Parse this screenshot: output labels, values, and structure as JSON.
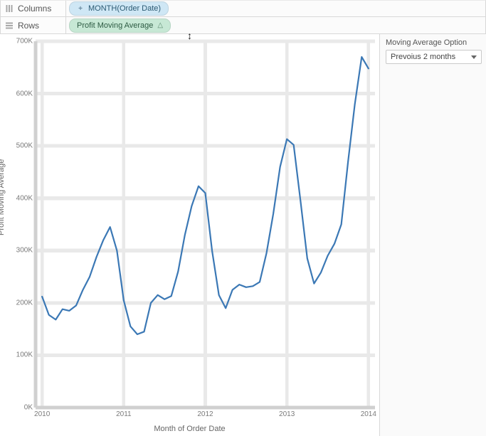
{
  "shelves": {
    "columns_label": "Columns",
    "rows_label": "Rows",
    "columns_pill": "MONTH(Order Date)",
    "rows_pill": "Profit Moving Average"
  },
  "parameter": {
    "title": "Moving Average Option",
    "value": "Prevoius 2 months"
  },
  "chart_data": {
    "type": "line",
    "xlabel": "Month of Order Date",
    "ylabel": "Profit Moving Average",
    "ylim": [
      0,
      700000
    ],
    "y_ticks": [
      0,
      100000,
      200000,
      300000,
      400000,
      500000,
      600000,
      700000
    ],
    "y_tick_labels": [
      "0K",
      "100K",
      "200K",
      "300K",
      "400K",
      "500K",
      "600K",
      "700K"
    ],
    "x_ticks": [
      2010,
      2011,
      2012,
      2013,
      2014
    ],
    "x_tick_labels": [
      "2010",
      "2011",
      "2012",
      "2013",
      "2014"
    ],
    "xlim": [
      2009.92,
      2014.08
    ],
    "series": [
      {
        "name": "Profit Moving Average",
        "color": "#3b78b5",
        "x": [
          2010.0,
          2010.083,
          2010.167,
          2010.25,
          2010.333,
          2010.417,
          2010.5,
          2010.583,
          2010.667,
          2010.75,
          2010.833,
          2010.917,
          2011.0,
          2011.083,
          2011.167,
          2011.25,
          2011.333,
          2011.417,
          2011.5,
          2011.583,
          2011.667,
          2011.75,
          2011.833,
          2011.917,
          2012.0,
          2012.083,
          2012.167,
          2012.25,
          2012.333,
          2012.417,
          2012.5,
          2012.583,
          2012.667,
          2012.75,
          2012.833,
          2012.917,
          2013.0,
          2013.083,
          2013.167,
          2013.25,
          2013.333,
          2013.417,
          2013.5,
          2013.583,
          2013.667,
          2013.75,
          2013.833,
          2013.917,
          2014.0
        ],
        "values": [
          212000,
          177000,
          168000,
          188000,
          185000,
          195000,
          225000,
          250000,
          288000,
          320000,
          345000,
          300000,
          205000,
          155000,
          140000,
          145000,
          200000,
          215000,
          207000,
          213000,
          260000,
          330000,
          385000,
          423000,
          410000,
          300000,
          215000,
          190000,
          225000,
          235000,
          230000,
          232000,
          240000,
          295000,
          370000,
          460000,
          513000,
          502000,
          395000,
          285000,
          237000,
          258000,
          290000,
          313000,
          350000,
          470000,
          580000,
          670000,
          648000
        ]
      }
    ]
  }
}
